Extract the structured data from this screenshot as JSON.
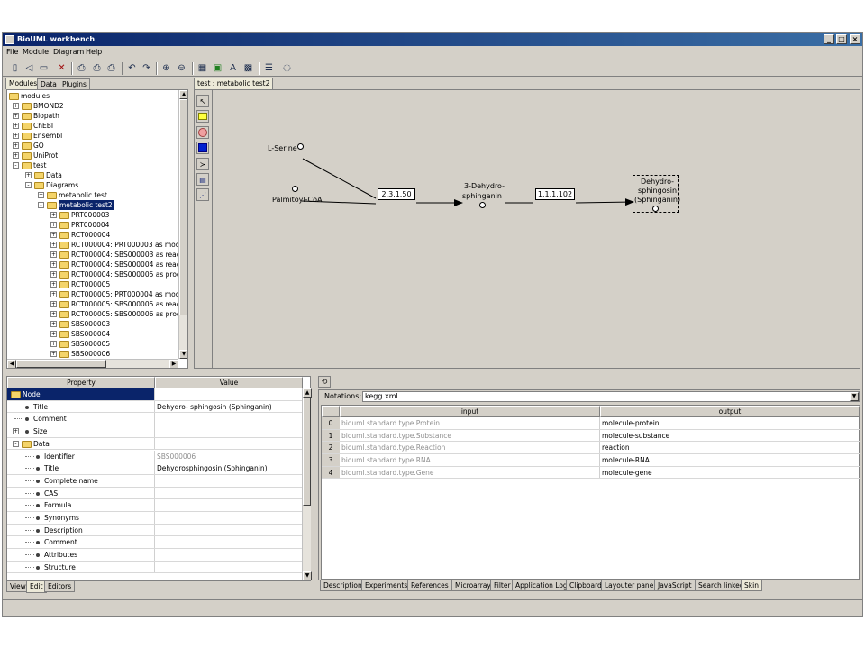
{
  "window": {
    "title": "BioUML workbench"
  },
  "menu": [
    "File",
    "Module",
    "Diagram",
    "Help"
  ],
  "toolbar_icons": [
    "new-icon",
    "open-icon",
    "save-icon",
    "delete-icon",
    "print-icon",
    "print-preview-icon",
    "page-setup-icon",
    "export-icon",
    "undo-icon",
    "redo-icon",
    "zoom-in-icon",
    "zoom-out-icon",
    "layout-icon",
    "refresh-icon",
    "text-icon",
    "image-icon",
    "options-icon",
    "help-icon"
  ],
  "left_tabs": [
    "Modules",
    "Data",
    "Plugins"
  ],
  "tree": [
    {
      "label": "modules",
      "level": 0,
      "exp": "-"
    },
    {
      "label": "BMOND2",
      "level": 1,
      "exp": "+"
    },
    {
      "label": "Biopath",
      "level": 1,
      "exp": "+"
    },
    {
      "label": "ChEBI",
      "level": 1,
      "exp": "+"
    },
    {
      "label": "Ensembl",
      "level": 1,
      "exp": "+"
    },
    {
      "label": "GO",
      "level": 1,
      "exp": "+"
    },
    {
      "label": "UniProt",
      "level": 1,
      "exp": "+"
    },
    {
      "label": "test",
      "level": 1,
      "exp": "-"
    },
    {
      "label": "Data",
      "level": 2,
      "exp": "+"
    },
    {
      "label": "Diagrams",
      "level": 2,
      "exp": "-"
    },
    {
      "label": "metabolic test",
      "level": 3,
      "exp": "+"
    },
    {
      "label": "metabolic test2",
      "level": 3,
      "exp": "-",
      "selected": true
    },
    {
      "label": "PRT000003",
      "level": 4,
      "exp": "+"
    },
    {
      "label": "PRT000004",
      "level": 4,
      "exp": "+"
    },
    {
      "label": "RCT000004",
      "level": 4,
      "exp": "+"
    },
    {
      "label": "RCT000004: PRT000003 as modifier",
      "level": 4,
      "exp": "+"
    },
    {
      "label": "RCT000004: SBS000003 as reactant",
      "level": 4,
      "exp": "+"
    },
    {
      "label": "RCT000004: SBS000004 as reactant",
      "level": 4,
      "exp": "+"
    },
    {
      "label": "RCT000004: SBS000005 as product:",
      "level": 4,
      "exp": "+"
    },
    {
      "label": "RCT000005",
      "level": 4,
      "exp": "+"
    },
    {
      "label": "RCT000005: PRT000004 as modifier",
      "level": 4,
      "exp": "+"
    },
    {
      "label": "RCT000005: SBS000005 as reactant",
      "level": 4,
      "exp": "+"
    },
    {
      "label": "RCT000005: SBS000006 as product:",
      "level": 4,
      "exp": "+"
    },
    {
      "label": "SBS000003",
      "level": 4,
      "exp": "+"
    },
    {
      "label": "SBS000004",
      "level": 4,
      "exp": "+"
    },
    {
      "label": "SBS000005",
      "level": 4,
      "exp": "+"
    },
    {
      "label": "SBS000006",
      "level": 4,
      "exp": "+"
    }
  ],
  "diagram": {
    "tab": "test : metabolic test2",
    "serine": "L-Serine",
    "palmitoyl": "Palmitoyl-CoA",
    "r1": "2.3.1.50",
    "mid_l1": "3-Dehydro-",
    "mid_l2": "sphinganin",
    "r2": "1.1.1.102",
    "end_l1": "Dehydro-",
    "end_l2": "sphingosin",
    "end_l3": "(Sphinganin)"
  },
  "props": {
    "header_property": "Property",
    "header_value": "Value",
    "rows": [
      {
        "name": "Node",
        "value": "",
        "level": 0,
        "type": "folder",
        "selected": true
      },
      {
        "name": "Title",
        "value": "Dehydro- sphingosin (Sphinganin)",
        "level": 1,
        "type": "leaf"
      },
      {
        "name": "Comment",
        "value": "",
        "level": 1,
        "type": "leaf"
      },
      {
        "name": "Size",
        "value": "",
        "level": 1,
        "type": "expand"
      },
      {
        "name": "Data",
        "value": "",
        "level": 1,
        "type": "folder"
      },
      {
        "name": "Identifier",
        "value": "SBS000006",
        "level": 2,
        "type": "leaf",
        "grey": true
      },
      {
        "name": "Title",
        "value": "Dehydrosphingosin (Sphinganin)",
        "level": 2,
        "type": "leaf"
      },
      {
        "name": "Complete name",
        "value": "",
        "level": 2,
        "type": "leaf"
      },
      {
        "name": "CAS",
        "value": "",
        "level": 2,
        "type": "leaf"
      },
      {
        "name": "Formula",
        "value": "",
        "level": 2,
        "type": "leaf"
      },
      {
        "name": "Synonyms",
        "value": "",
        "level": 2,
        "type": "leaf"
      },
      {
        "name": "Description",
        "value": "",
        "level": 2,
        "type": "leaf"
      },
      {
        "name": "Comment",
        "value": "",
        "level": 2,
        "type": "leaf"
      },
      {
        "name": "Attributes",
        "value": "",
        "level": 2,
        "type": "leaf"
      },
      {
        "name": "Structure",
        "value": "",
        "level": 2,
        "type": "leaf"
      }
    ]
  },
  "left_bottom_tabs": [
    "View",
    "Edit",
    "Editors"
  ],
  "notation": {
    "label": "Notations:",
    "value": "kegg.xml",
    "header_input": "input",
    "header_output": "output",
    "rows": [
      {
        "idx": "0",
        "input": "biouml.standard.type.Protein",
        "output": "molecule-protein"
      },
      {
        "idx": "1",
        "input": "biouml.standard.type.Substance",
        "output": "molecule-substance"
      },
      {
        "idx": "2",
        "input": "biouml.standard.type.Reaction",
        "output": "reaction"
      },
      {
        "idx": "3",
        "input": "biouml.standard.type.RNA",
        "output": "molecule-RNA"
      },
      {
        "idx": "4",
        "input": "biouml.standard.type.Gene",
        "output": "molecule-gene"
      }
    ]
  },
  "right_bottom_tabs": [
    "Description",
    "Experiments",
    "References",
    "Microarray",
    "Filter",
    "Application Log",
    "Clipboard",
    "Layouter pane",
    "JavaScript",
    "Search linked",
    "Skin"
  ]
}
